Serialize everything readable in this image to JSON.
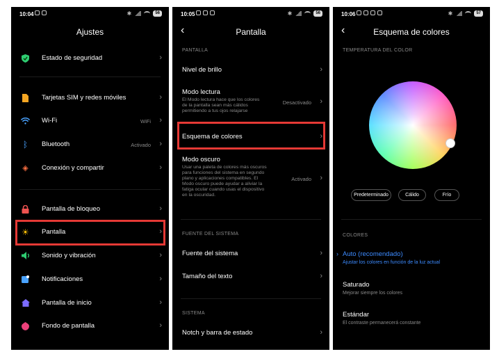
{
  "screen1": {
    "status": {
      "time": "10:04",
      "battery": "56"
    },
    "title": "Ajustes",
    "items": [
      {
        "label": "Estado de seguridad",
        "value": ""
      },
      {
        "label": "Tarjetas SIM y redes móviles",
        "value": ""
      },
      {
        "label": "Wi-Fi",
        "value": "WiFi"
      },
      {
        "label": "Bluetooth",
        "value": "Activado"
      },
      {
        "label": "Conexión y compartir",
        "value": ""
      },
      {
        "label": "Pantalla de bloqueo",
        "value": ""
      },
      {
        "label": "Pantalla",
        "value": ""
      },
      {
        "label": "Sonido y vibración",
        "value": ""
      },
      {
        "label": "Notificaciones",
        "value": ""
      },
      {
        "label": "Pantalla de inicio",
        "value": ""
      },
      {
        "label": "Fondo de pantalla",
        "value": ""
      }
    ]
  },
  "screen2": {
    "status": {
      "time": "10:05",
      "battery": "56"
    },
    "title": "Pantalla",
    "section_display": "PANTALLA",
    "brightness": "Nivel de brillo",
    "reading_mode": {
      "label": "Modo lectura",
      "desc1": "El Modo lectura hace que los colores",
      "desc2": "de la pantalla sean más cálidos",
      "desc3": "permitiendo a tus ojos relajarse",
      "value": "Desactivado"
    },
    "color_scheme": "Esquema de colores",
    "dark_mode": {
      "label": "Modo oscuro",
      "desc1": "Usar una paleta de colores más oscuros",
      "desc2": "para funciones del sistema en segundo",
      "desc3": "plano y aplicaciones compatibles. El",
      "desc4": "Modo oscuro puede ayudar a aliviar la",
      "desc5": "fatiga ocular cuando usas el dispositivo",
      "desc6": "en la oscuridad.",
      "value": "Activado"
    },
    "section_font": "FUENTE DEL SISTEMA",
    "system_font": "Fuente del sistema",
    "text_size": "Tamaño del texto",
    "section_system": "SISTEMA",
    "notch": "Notch y barra de estado"
  },
  "screen3": {
    "status": {
      "time": "10:06",
      "battery": "57"
    },
    "title": "Esquema de colores",
    "section_temp": "TEMPERATURA DEL COLOR",
    "presets": [
      "Predeterminado",
      "Cálido",
      "Frío"
    ],
    "section_colors": "COLORES",
    "options": [
      {
        "label": "Auto (recomendado)",
        "desc": "Ajustar los colores en función de la luz actual",
        "selected": true
      },
      {
        "label": "Saturado",
        "desc": "Mejorar siempre los colores",
        "selected": false
      },
      {
        "label": "Estándar",
        "desc": "El contraste permanecerá constante",
        "selected": false
      }
    ],
    "accent": "#3d8bff"
  },
  "colors": {
    "highlight": "#e53935",
    "background": "#000000"
  }
}
